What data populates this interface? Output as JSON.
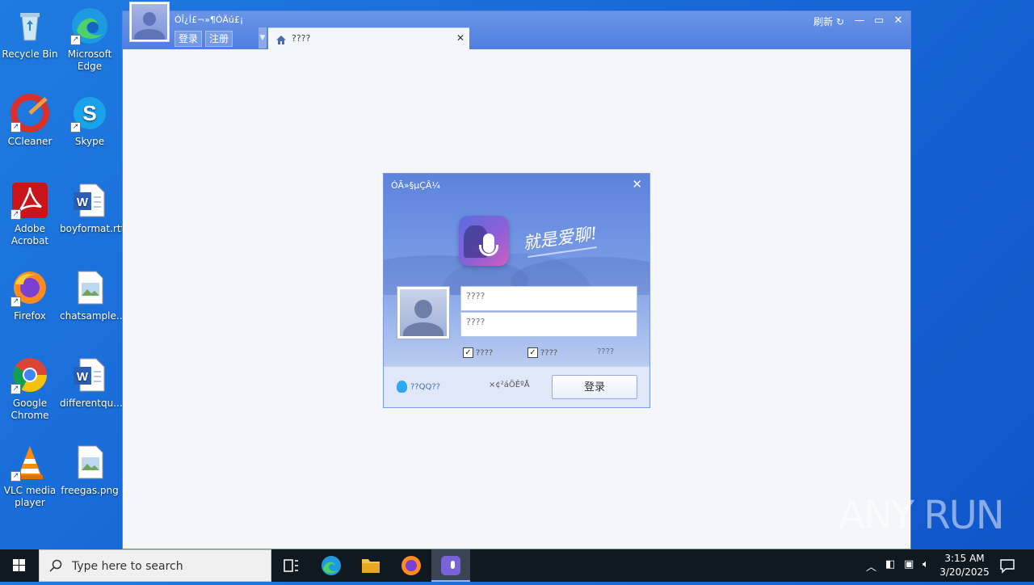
{
  "desktop": {
    "icons": [
      {
        "label": "Recycle Bin"
      },
      {
        "label": "Microsoft Edge"
      },
      {
        "label": "CCleaner"
      },
      {
        "label": "Skype"
      },
      {
        "label": "Adobe Acrobat"
      },
      {
        "label": "boyformat.rtf"
      },
      {
        "label": "Firefox"
      },
      {
        "label": "chatsample..."
      },
      {
        "label": "Google Chrome"
      },
      {
        "label": "differentqu..."
      },
      {
        "label": "VLC media player"
      },
      {
        "label": "freegas.png"
      }
    ]
  },
  "app": {
    "title": "ÓÎ¿Í£¬»¶Ó­Äú£¡",
    "login_label": "登录",
    "register_label": "注册",
    "tab_label": "????",
    "refresh_label": "刷新",
    "accent_color": "#4f7fe0"
  },
  "dialog": {
    "title": "ÓÃ»§µÇÂ¼",
    "slogan": "就是爱聊!",
    "username_placeholder": "????",
    "password_placeholder": "????",
    "remember_label": "????",
    "auto_login_label": "????",
    "forgot_label": "????",
    "qq_login_label": "??QQ??",
    "register_link": "×¢²áÕÊºÅ",
    "login_button": "登录"
  },
  "taskbar": {
    "search_placeholder": "Type here to search",
    "time": "3:15 AM",
    "date": "3/20/2025"
  },
  "watermark": "ANY RUN"
}
